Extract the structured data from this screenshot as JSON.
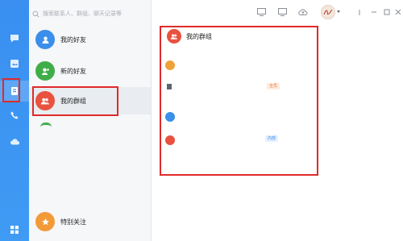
{
  "search": {
    "placeholder": "搜索联系人、群组、聊天记录等"
  },
  "contacts": {
    "items": [
      {
        "label": "我的好友",
        "color": "#3b8eea"
      },
      {
        "label": "新的好友",
        "color": "#3fae49"
      },
      {
        "label": "我的群组",
        "color": "#e8523f"
      }
    ],
    "special": {
      "label": "特别关注",
      "color": "#f29a38"
    }
  },
  "group_panel": {
    "title": "我的群组",
    "tags": [
      {
        "text": "全员",
        "color": "#e8813a"
      },
      {
        "text": "内部",
        "color": "#3b8eea"
      }
    ]
  },
  "colors": {
    "accent": "#3a8ff0",
    "highlight_box": "#e02a2a"
  }
}
